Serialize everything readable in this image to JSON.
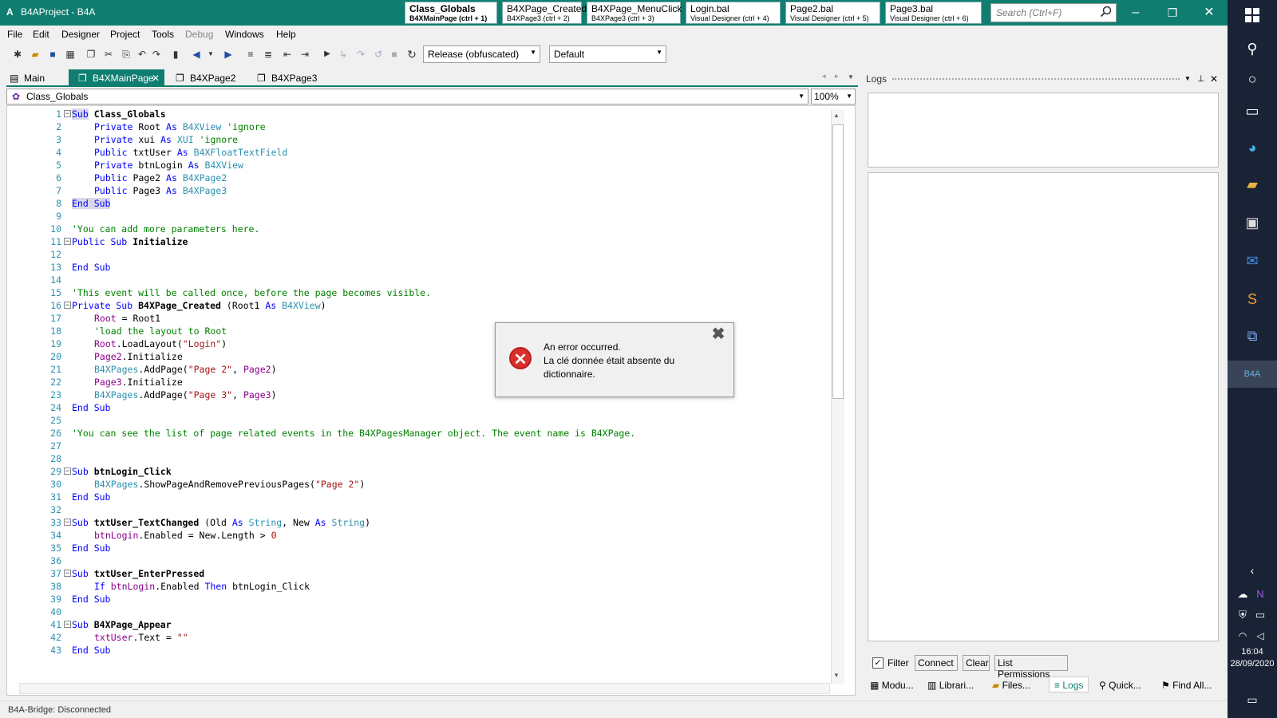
{
  "window": {
    "title": "B4AProject - B4A",
    "app_glyph": "A",
    "controls": {
      "minimize": "–",
      "maximize": "❐",
      "close": "✕"
    }
  },
  "quick_tabs": [
    {
      "title": "Class_Globals",
      "sub": "B4XMainPage  (ctrl + 1)"
    },
    {
      "title": "B4XPage_Created",
      "sub": "B4XPage3  (ctrl + 2)"
    },
    {
      "title": "B4XPage_MenuClick",
      "sub": "B4XPage3  (ctrl + 3)"
    },
    {
      "title": "Login.bal",
      "sub": "Visual Designer  (ctrl + 4)"
    },
    {
      "title": "Page2.bal",
      "sub": "Visual Designer  (ctrl + 5)"
    },
    {
      "title": "Page3.bal",
      "sub": "Visual Designer  (ctrl + 6)"
    }
  ],
  "search": {
    "placeholder": "Search (Ctrl+F)"
  },
  "menu": [
    "File",
    "Edit",
    "Designer",
    "Project",
    "Tools",
    "Debug",
    "Windows",
    "Help"
  ],
  "toolbar": {
    "build_config": "Release (obfuscated)",
    "device": "Default"
  },
  "doc_tabs": [
    {
      "label": "Main"
    },
    {
      "label": "B4XMainPage",
      "active": true
    },
    {
      "label": "B4XPage2"
    },
    {
      "label": "B4XPage3"
    }
  ],
  "editor": {
    "navigator": "Class_Globals",
    "zoom": "100%"
  },
  "code_lines": [
    "1",
    "2",
    "3",
    "4",
    "5",
    "6",
    "7",
    "8",
    "9",
    "10",
    "11",
    "12",
    "13",
    "14",
    "15",
    "16",
    "17",
    "18",
    "19",
    "20",
    "21",
    "22",
    "23",
    "24",
    "25",
    "26",
    "27",
    "28",
    "29",
    "30",
    "31",
    "32",
    "33",
    "34",
    "35",
    "36",
    "37",
    "38",
    "39",
    "40",
    "41",
    "42",
    "43"
  ],
  "code": {
    "l1": [
      "Sub",
      " ",
      "Class_Globals"
    ],
    "l2": [
      "Private",
      " Root ",
      "As",
      " ",
      "B4XView",
      " 'ignore"
    ],
    "l3": [
      "Private",
      " xui ",
      "As",
      " ",
      "XUI",
      " 'ignore"
    ],
    "l4": [
      "Public",
      " txtUser ",
      "As",
      " ",
      "B4XFloatTextField"
    ],
    "l5": [
      "Private",
      " btnLogin ",
      "As",
      " ",
      "B4XView"
    ],
    "l6": [
      "Public",
      " Page2 ",
      "As",
      " ",
      "B4XPage2"
    ],
    "l7": [
      "Public",
      " Page3 ",
      "As",
      " ",
      "B4XPage3"
    ],
    "l8": [
      "End Sub"
    ],
    "l10": [
      "'You can add more parameters here."
    ],
    "l11": [
      "Public Sub",
      " ",
      "Initialize"
    ],
    "l13": [
      "End Sub"
    ],
    "l15": [
      "'This event will be called once, before the page becomes visible."
    ],
    "l16": [
      "Private Sub",
      " ",
      "B4XPage_Created",
      " (Root1 ",
      "As",
      " ",
      "B4XView",
      ")"
    ],
    "l17": [
      "Root",
      " = Root1"
    ],
    "l18": [
      "'load the layout to Root"
    ],
    "l19": [
      "Root",
      ".LoadLayout(",
      "\"Login\"",
      ")"
    ],
    "l20": [
      "Page2",
      ".Initialize"
    ],
    "l21": [
      "B4XPages",
      ".AddPage(",
      "\"Page 2\"",
      ", ",
      "Page2",
      ")"
    ],
    "l22": [
      "Page3",
      ".Initialize"
    ],
    "l23": [
      "B4XPages",
      ".AddPage(",
      "\"Page 3\"",
      ", ",
      "Page3",
      ")"
    ],
    "l24": [
      "End Sub"
    ],
    "l26": [
      "'You can see the list of page related events in the B4XPagesManager object. The event name is B4XPage."
    ],
    "l29": [
      "Sub",
      " ",
      "btnLogin_Click"
    ],
    "l30": [
      "B4XPages",
      ".ShowPageAndRemovePreviousPages(",
      "\"Page 2\"",
      ")"
    ],
    "l31": [
      "End Sub"
    ],
    "l33": [
      "Sub",
      " ",
      "txtUser_TextChanged",
      " (Old ",
      "As",
      " ",
      "String",
      ", New ",
      "As",
      " ",
      "String",
      ")"
    ],
    "l34": [
      "btnLogin",
      ".Enabled = New.Length > ",
      "0"
    ],
    "l35": [
      "End Sub"
    ],
    "l37": [
      "Sub",
      " ",
      "txtUser_EnterPressed"
    ],
    "l38": [
      "If",
      " ",
      "btnLogin",
      ".Enabled ",
      "Then",
      " btnLogin_Click"
    ],
    "l39": [
      "End Sub"
    ],
    "l41": [
      "Sub",
      " ",
      "B4XPage_Appear"
    ],
    "l42": [
      "txtUser",
      ".Text = ",
      "\"\""
    ],
    "l43": [
      "End Sub"
    ]
  },
  "error_dialog": {
    "line1": "An error occurred.",
    "line2": "La clé donnée était absente du dictionnaire.",
    "icon_glyph": "✕",
    "close_glyph": "✖"
  },
  "logs": {
    "title": "Logs",
    "filter_label": "Filter",
    "connect": "Connect",
    "clear": "Clear",
    "list_permissions": "List Permissions",
    "bottom_tabs": [
      "Modu...",
      "Librari...",
      "Files...",
      "Logs",
      "Quick...",
      "Find All..."
    ]
  },
  "status": {
    "text": "B4A-Bridge: Disconnected"
  },
  "clock": {
    "time": "16:04",
    "date": "28/09/2020"
  },
  "colors": {
    "accent": "#0f7e70",
    "error": "#d9302c",
    "taskbar": "#1a2236"
  }
}
